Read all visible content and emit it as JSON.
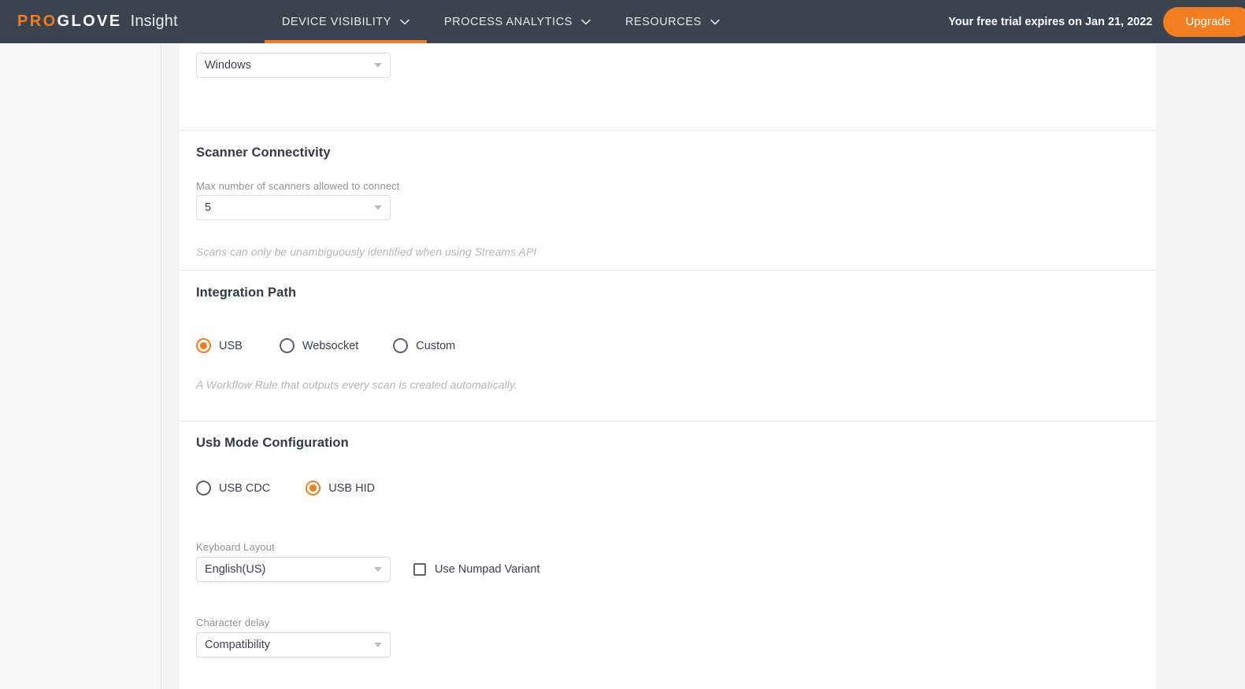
{
  "topnav": {
    "brand": {
      "pro": "PRO",
      "glove": "GLOVE",
      "product": "Insight"
    },
    "items": [
      {
        "label": "DEVICE VISIBILITY",
        "caret": "chevron-down-icon",
        "active": true
      },
      {
        "label": "PROCESS ANALYTICS",
        "caret": "chevron-down-icon",
        "active": false
      },
      {
        "label": "RESOURCES",
        "caret": "chevron-down-icon",
        "active": false
      }
    ],
    "caret_glyph": "⌄",
    "trial_text": "Your free trial expires on Jan 21, 2022",
    "upgrade_label": "Upgrade",
    "accent_color": "#f07d1f",
    "bar_color": "#3c4350"
  },
  "platform_section": {
    "select_value": "Windows"
  },
  "scanner_connectivity": {
    "title": "Scanner Connectivity",
    "field_label": "Max number of scanners allowed to connect",
    "select_value": "5",
    "hint": "Scans can only be unambiguously identified when using Streams API"
  },
  "integration_path": {
    "title": "Integration Path",
    "options": [
      {
        "label": "USB",
        "selected": true
      },
      {
        "label": "Websocket",
        "selected": false
      },
      {
        "label": "Custom",
        "selected": false
      }
    ],
    "hint": "A Workflow Rule that outputs every scan is created automatically."
  },
  "usb_mode": {
    "title": "Usb Mode Configuration",
    "options": [
      {
        "label": "USB CDC",
        "selected": false
      },
      {
        "label": "USB HID",
        "selected": true
      }
    ],
    "keyboard_layout_label": "Keyboard Layout",
    "keyboard_layout_value": "English(US)",
    "numpad_label": "Use Numpad Variant",
    "numpad_checked": false,
    "character_delay_label": "Character delay",
    "character_delay_value": "Compatibility"
  }
}
